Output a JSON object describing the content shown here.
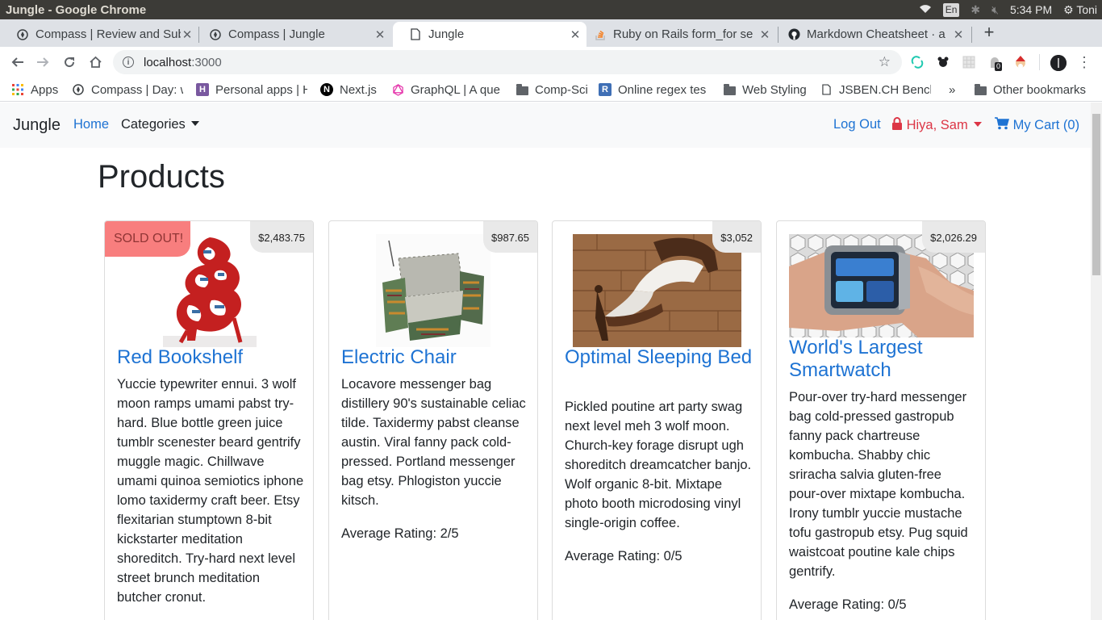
{
  "os": {
    "window_title": "Jungle - Google Chrome",
    "lang": "En",
    "time": "5:34 PM",
    "user": "Toni"
  },
  "tabs": [
    {
      "label": "Compass | Review and Sub",
      "icon": "compass-icon"
    },
    {
      "label": "Compass | Jungle",
      "icon": "compass-icon"
    },
    {
      "label": "Jungle",
      "icon": "page-icon"
    },
    {
      "label": "Ruby on Rails form_for se",
      "icon": "stackoverflow-icon"
    },
    {
      "label": "Markdown Cheatsheet · a",
      "icon": "github-icon"
    }
  ],
  "address": {
    "host": "localhost",
    "port": ":3000"
  },
  "extensions": {
    "badge_count": "0"
  },
  "bookmarks": [
    {
      "label": "Apps",
      "icon": "apps-grid-icon"
    },
    {
      "label": "Compass | Day: w",
      "icon": "compass-icon"
    },
    {
      "label": "Personal apps | H",
      "icon": "heroku-icon"
    },
    {
      "label": "Next.js",
      "icon": "nextjs-icon"
    },
    {
      "label": "GraphQL | A que",
      "icon": "graphql-icon"
    },
    {
      "label": "Comp-Sci",
      "icon": "folder-icon"
    },
    {
      "label": "Online regex tes",
      "icon": "regex-icon"
    },
    {
      "label": "Web Styling",
      "icon": "folder-icon"
    },
    {
      "label": "JSBEN.CH Bench",
      "icon": "page-icon"
    },
    {
      "label": "Other bookmarks",
      "icon": "folder-icon"
    }
  ],
  "bookmarks_overflow": "»",
  "app": {
    "brand": "Jungle",
    "home": "Home",
    "categories": "Categories",
    "logout": "Log Out",
    "greeting": "Hiya, Sam",
    "cart": "My Cart (0)",
    "page_title": "Products"
  },
  "products": [
    {
      "name": "Red Bookshelf",
      "price": "$2,483.75",
      "sold_out": "SOLD OUT!",
      "description": "Yuccie typewriter ennui. 3 wolf moon ramps umami pabst try-hard. Blue bottle green juice tumblr scenester beard gentrify muggle magic. Chillwave umami quinoa semiotics iphone lomo taxidermy craft beer. Etsy flexitarian stumptown 8-bit kickstarter meditation shoreditch. Try-hard next level street brunch meditation butcher cronut.",
      "rating": ""
    },
    {
      "name": "Electric Chair",
      "price": "$987.65",
      "description": "Locavore messenger bag distillery 90's sustainable celiac tilde. Taxidermy pabst cleanse austin. Viral fanny pack cold-pressed. Portland messenger bag etsy. Phlogiston yuccie kitsch.",
      "rating": "Average Rating: 2/5"
    },
    {
      "name": "Optimal Sleeping Bed",
      "price": "$3,052",
      "description": "Pickled poutine art party swag next level meh 3 wolf moon. Church-key forage disrupt ugh shoreditch dreamcatcher banjo. Wolf organic 8-bit. Mixtape photo booth microdosing vinyl single-origin coffee.",
      "rating": "Average Rating: 0/5"
    },
    {
      "name": "World's Largest Smartwatch",
      "price": "$2,026.29",
      "description": "Pour-over try-hard messenger bag cold-pressed gastropub fanny pack chartreuse kombucha. Shabby chic sriracha salvia gluten-free pour-over mixtape kombucha. Irony tumblr yuccie mustache tofu gastropub etsy. Pug squid waistcoat poutine kale chips gentrify.",
      "rating": "Average Rating: 0/5"
    }
  ]
}
